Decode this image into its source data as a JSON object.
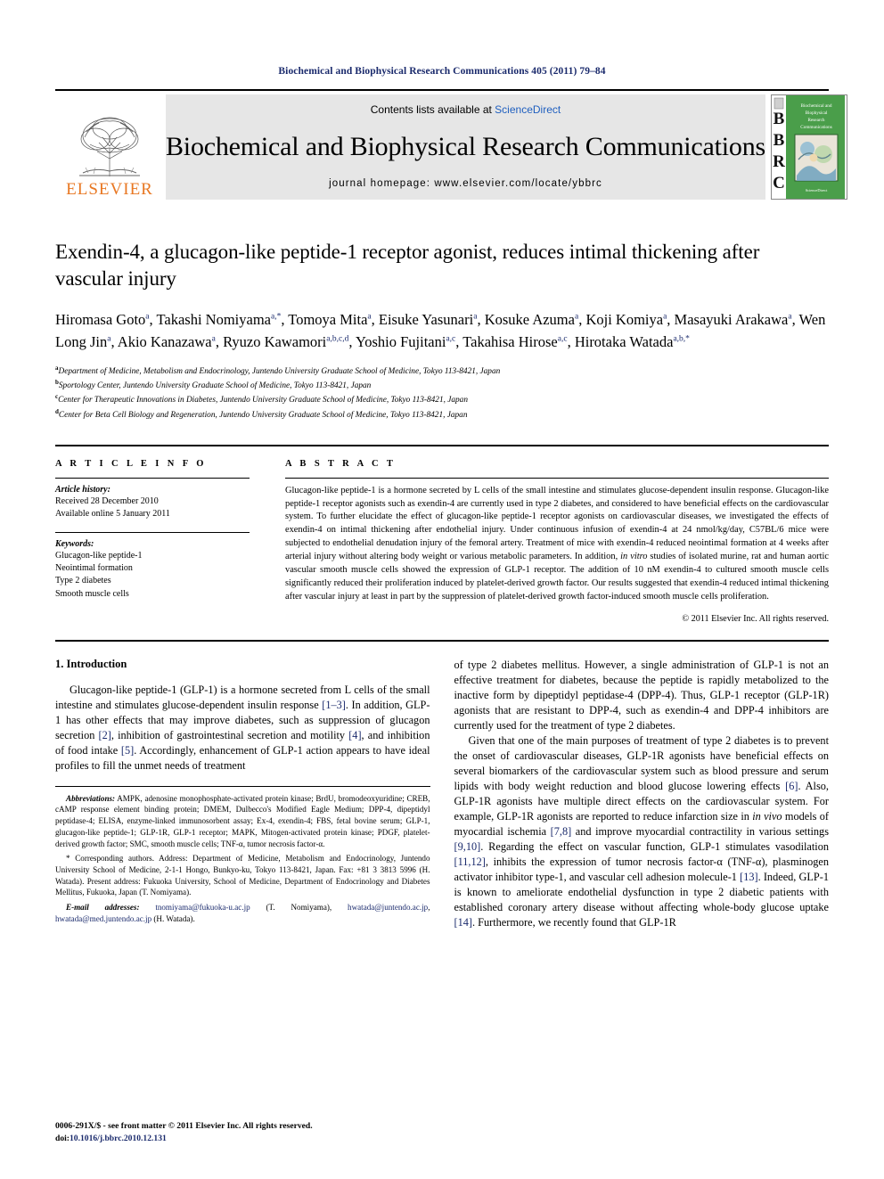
{
  "running_head": "Biochemical and Biophysical Research Communications 405 (2011) 79–84",
  "masthead": {
    "publisher_name": "ELSEVIER",
    "contents_prefix": "Contents lists available at ",
    "contents_link": "ScienceDirect",
    "journal_name": "Biochemical and Biophysical Research Communications",
    "homepage": "journal homepage: www.elsevier.com/locate/ybbrc",
    "cover_letters": [
      "B",
      "B",
      "R",
      "C"
    ],
    "cover_title": "Biochemical and Biophysical Research Communications",
    "cover_footer": "ScienceDirect",
    "link_color": "#1f5fbf",
    "brand_color": "#E87722"
  },
  "article": {
    "title": "Exendin-4, a glucagon-like peptide-1 receptor agonist, reduces intimal thickening after vascular injury",
    "authors": [
      {
        "name": "Hiromasa Goto",
        "sup": "a",
        "sep": ", "
      },
      {
        "name": "Takashi Nomiyama",
        "sup": "a,*",
        "sep": ", "
      },
      {
        "name": "Tomoya Mita",
        "sup": "a",
        "sep": ", "
      },
      {
        "name": "Eisuke Yasunari",
        "sup": "a",
        "sep": ", "
      },
      {
        "name": "Kosuke Azuma",
        "sup": "a",
        "sep": ", "
      },
      {
        "name": "Koji Komiya",
        "sup": "a",
        "sep": ", "
      },
      {
        "name": "Masayuki Arakawa",
        "sup": "a",
        "sep": ", "
      },
      {
        "name": "Wen Long Jin",
        "sup": "a",
        "sep": ", "
      },
      {
        "name": "Akio Kanazawa",
        "sup": "a",
        "sep": ", "
      },
      {
        "name": "Ryuzo Kawamori",
        "sup": "a,b,c,d",
        "sep": ", "
      },
      {
        "name": "Yoshio Fujitani",
        "sup": "a,c",
        "sep": ", "
      },
      {
        "name": "Takahisa Hirose",
        "sup": "a,c",
        "sep": ", "
      },
      {
        "name": "Hirotaka Watada",
        "sup": "a,b,*",
        "sep": ""
      }
    ],
    "affiliations": [
      {
        "marker": "a",
        "text": "Department of Medicine, Metabolism and Endocrinology, Juntendo University Graduate School of Medicine, Tokyo 113-8421, Japan"
      },
      {
        "marker": "b",
        "text": "Sportology Center, Juntendo University Graduate School of Medicine, Tokyo 113-8421, Japan"
      },
      {
        "marker": "c",
        "text": "Center for Therapeutic Innovations in Diabetes, Juntendo University Graduate School of Medicine, Tokyo 113-8421, Japan"
      },
      {
        "marker": "d",
        "text": "Center for Beta Cell Biology and Regeneration, Juntendo University Graduate School of Medicine, Tokyo 113-8421, Japan"
      }
    ]
  },
  "article_info": {
    "heading": "A R T I C L E  I N F O",
    "history_label": "Article history:",
    "history": [
      "Received 28 December 2010",
      "Available online 5 January 2011"
    ],
    "keywords_label": "Keywords:",
    "keywords": [
      "Glucagon-like peptide-1",
      "Neointimal formation",
      "Type 2 diabetes",
      "Smooth muscle cells"
    ]
  },
  "abstract": {
    "heading": "A B S T R A C T",
    "body_part1": "Glucagon-like peptide-1 is a hormone secreted by L cells of the small intestine and stimulates glucose-dependent insulin response. Glucagon-like peptide-1 receptor agonists such as exendin-4 are currently used in type 2 diabetes, and considered to have beneficial effects on the cardiovascular system. To further elucidate the effect of glucagon-like peptide-1 receptor agonists on cardiovascular diseases, we investigated the effects of exendin-4 on intimal thickening after endothelial injury. Under continuous infusion of exendin-4 at 24 nmol/kg/day, C57BL/6 mice were subjected to endothelial denudation injury of the femoral artery. Treatment of mice with exendin-4 reduced neointimal formation at 4 weeks after arterial injury without altering body weight or various metabolic parameters. In addition, ",
    "italic1": "in vitro",
    "body_part2": " studies of isolated murine, rat and human aortic vascular smooth muscle cells showed the expression of GLP-1 receptor. The addition of 10 nM exendin-4 to cultured smooth muscle cells significantly reduced their proliferation induced by platelet-derived growth factor. Our results suggested that exendin-4 reduced intimal thickening after vascular injury at least in part by the suppression of platelet-derived growth factor-induced smooth muscle cells proliferation.",
    "copyright": "© 2011 Elsevier Inc. All rights reserved."
  },
  "introduction": {
    "title": "1. Introduction",
    "left_para_1a": "Glucagon-like peptide-1 (GLP-1) is a hormone secreted from L cells of the small intestine and stimulates glucose-dependent insulin response ",
    "ref_1_3": "[1–3]",
    "left_para_1b": ". In addition, GLP-1 has other effects that may improve diabetes, such as suppression of glucagon secretion ",
    "ref_2": "[2]",
    "left_para_1c": ", inhibition of gastrointestinal secretion and motility ",
    "ref_4": "[4]",
    "left_para_1d": ", and inhibition of food intake ",
    "ref_5": "[5]",
    "left_para_1e": ". Accordingly, enhancement of GLP-1 action appears to have ideal profiles to fill the unmet needs of treatment",
    "right_para_1": "of type 2 diabetes mellitus. However, a single administration of GLP-1 is not an effective treatment for diabetes, because the peptide is rapidly metabolized to the inactive form by dipeptidyl peptidase-4 (DPP-4). Thus, GLP-1 receptor (GLP-1R) agonists that are resistant to DPP-4, such as exendin-4 and DPP-4 inhibitors are currently used for the treatment of type 2 diabetes.",
    "right_para_2a": "Given that one of the main purposes of treatment of type 2 diabetes is to prevent the onset of cardiovascular diseases, GLP-1R agonists have beneficial effects on several biomarkers of the cardiovascular system such as blood pressure and serum lipids with body weight reduction and blood glucose lowering effects ",
    "ref_6": "[6]",
    "right_para_2b": ". Also, GLP-1R agonists have multiple direct effects on the cardiovascular system. For example, GLP-1R agonists are reported to reduce infarction size in ",
    "italic_invivo": "in vivo",
    "right_para_2c": " models of myocardial ischemia ",
    "ref_7_8": "[7,8]",
    "right_para_2d": " and improve myocardial contractility in various settings ",
    "ref_9_10": "[9,10]",
    "right_para_2e": ". Regarding the effect on vascular function, GLP-1 stimulates vasodilation ",
    "ref_11_12": "[11,12]",
    "right_para_2f": ", inhibits the expression of tumor necrosis factor-α (TNF-α), plasminogen activator inhibitor type-1, and vascular cell adhesion molecule-1 ",
    "ref_13": "[13]",
    "right_para_2g": ". Indeed, GLP-1 is known to ameliorate endothelial dysfunction in type 2 diabetic patients with established coronary artery disease without affecting whole-body glucose uptake ",
    "ref_14": "[14]",
    "right_para_2h": ". Furthermore, we recently found that GLP-1R"
  },
  "footnotes": {
    "abbrev_label": "Abbreviations:",
    "abbrev_text": " AMPK, adenosine monophosphate-activated protein kinase; BrdU, bromodeoxyuridine; CREB, cAMP response element binding protein; DMEM, Dulbecco's Modified Eagle Medium; DPP-4, dipeptidyl peptidase-4; ELISA, enzyme-linked immunosorbent assay; Ex-4, exendin-4; FBS, fetal bovine serum; GLP-1, glucagon-like peptide-1; GLP-1R, GLP-1 receptor; MAPK, Mitogen-activated protein kinase; PDGF, platelet-derived growth factor; SMC, smooth muscle cells; TNF-α, tumor necrosis factor-α.",
    "corresponding_marker": "*",
    "corresponding_text": " Corresponding authors. Address: Department of Medicine, Metabolism and Endocrinology, Juntendo University School of Medicine, 2-1-1 Hongo, Bunkyo-ku, Tokyo 113-8421, Japan. Fax: +81 3 3813 5996 (H. Watada). Present address: Fukuoka University, School of Medicine, Department of Endocrinology and Diabetes Mellitus, Fukuoka, Japan (T. Nomiyama).",
    "email_label": "E-mail addresses:",
    "email_1": "tnomiyama@fukuoka-u.ac.jp",
    "email_1_owner": " (T. Nomiyama), ",
    "email_2": "hwatada@juntendo.ac.jp",
    "email_sep": ", ",
    "email_3": "hwatada@med.juntendo.ac.jp",
    "email_3_owner": " (H. Watada)."
  },
  "footer": {
    "issn_line": "0006-291X/$ - see front matter © 2011 Elsevier Inc. All rights reserved.",
    "doi_label": "doi:",
    "doi_value": "10.1016/j.bbrc.2010.12.131"
  }
}
